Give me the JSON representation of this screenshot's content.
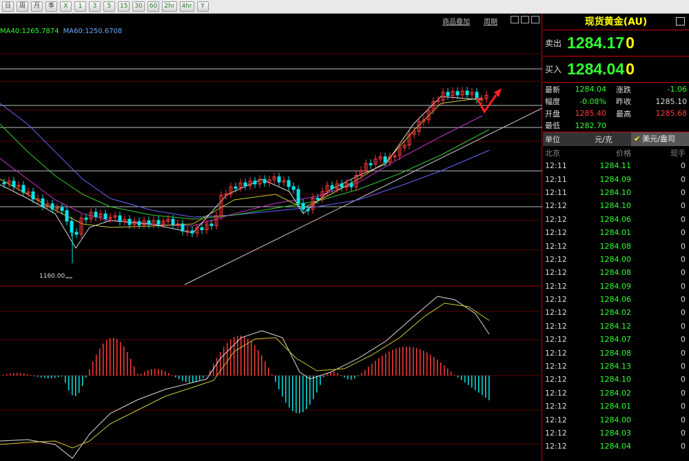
{
  "toolbar": {
    "buttons": [
      "日",
      "周",
      "月",
      "季",
      "X",
      "1",
      "3",
      "5",
      "15",
      "30",
      "60",
      "2hr",
      "4hr",
      "Y"
    ]
  },
  "chart_header": {
    "link_overlay": "商品叠加",
    "link_period": "周期",
    "ma_text": [
      {
        "text": "MA40:1265.7874",
        "color": "#33ff33"
      },
      {
        "text": "MA60:1250.6708",
        "color": "#66aaff"
      }
    ],
    "low_label": "1160.00"
  },
  "panel": {
    "title": "现货黄金(AU)",
    "sell_label": "卖出",
    "sell_price": "1284.17",
    "sell_volume": "0",
    "buy_label": "买入",
    "buy_price": "1284.04",
    "buy_volume": "0",
    "stats": [
      {
        "k": "最新",
        "v": "1284.04",
        "vc": "g",
        "k2": "涨跌",
        "v2": "-1.06",
        "v2c": "g"
      },
      {
        "k": "幅度",
        "v": "-0.08%",
        "vc": "g",
        "k2": "昨收",
        "v2": "1285.10",
        "v2c": "w"
      },
      {
        "k": "开盘",
        "v": "1285.40",
        "vc": "r",
        "k2": "最高",
        "v2": "1285.68",
        "v2c": "r"
      },
      {
        "k": "最低",
        "v": "1282.70",
        "vc": "g",
        "k2": "",
        "v2": "",
        "v2c": "w"
      }
    ],
    "unit_label": "单位",
    "unit_value": "元/克",
    "unit_alt": "美元/盎司",
    "ticks_header": {
      "time": "北京",
      "price": "价格",
      "vol": "现手"
    },
    "ticks": [
      {
        "t": "12:11",
        "p": "1284.11",
        "v": "0"
      },
      {
        "t": "12:11",
        "p": "1284.09",
        "v": "0"
      },
      {
        "t": "12:11",
        "p": "1284.10",
        "v": "0"
      },
      {
        "t": "12:12",
        "p": "1284.10",
        "v": "0"
      },
      {
        "t": "12:12",
        "p": "1284.06",
        "v": "0"
      },
      {
        "t": "12:12",
        "p": "1284.01",
        "v": "0"
      },
      {
        "t": "12:12",
        "p": "1284.08",
        "v": "0"
      },
      {
        "t": "12:12",
        "p": "1284.00",
        "v": "0"
      },
      {
        "t": "12:12",
        "p": "1284.08",
        "v": "0"
      },
      {
        "t": "12:12",
        "p": "1284.09",
        "v": "0"
      },
      {
        "t": "12:12",
        "p": "1284.06",
        "v": "0"
      },
      {
        "t": "12:12",
        "p": "1284.02",
        "v": "0"
      },
      {
        "t": "12:12",
        "p": "1284.12",
        "v": "0"
      },
      {
        "t": "12:12",
        "p": "1284.07",
        "v": "0"
      },
      {
        "t": "12:12",
        "p": "1284.08",
        "v": "0"
      },
      {
        "t": "12:12",
        "p": "1284.13",
        "v": "0"
      },
      {
        "t": "12:12",
        "p": "1284.10",
        "v": "0"
      },
      {
        "t": "12:12",
        "p": "1284.02",
        "v": "0"
      },
      {
        "t": "12:12",
        "p": "1284.01",
        "v": "0"
      },
      {
        "t": "12:12",
        "p": "1284.00",
        "v": "0"
      },
      {
        "t": "12:12",
        "p": "1284.03",
        "v": "0"
      },
      {
        "t": "12:12",
        "p": "1284.04",
        "v": "0"
      }
    ]
  },
  "colors": {
    "up": "#ff3b3b",
    "down": "#00e5e5",
    "accent": "#ffff00"
  }
}
